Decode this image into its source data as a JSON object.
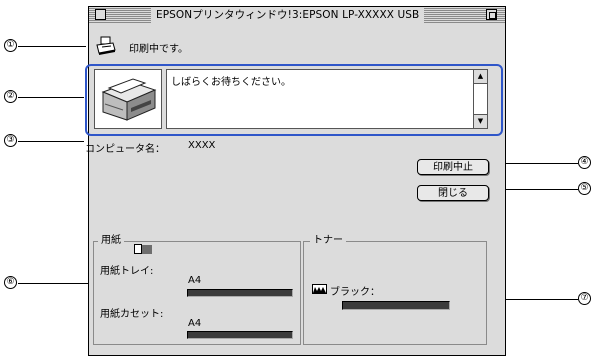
{
  "window": {
    "title": "EPSONプリンタウィンドウ!3:EPSON LP-XXXXX USB",
    "status_text": "印刷中です。",
    "message": "しばらくお待ちください。",
    "computer_label": "コンピュータ名：",
    "computer_name": "XXXX",
    "buttons": {
      "cancel_print": "印刷中止",
      "close": "閉じる"
    },
    "paper_group": {
      "legend": "用紙",
      "tray_label": "用紙トレイ:",
      "tray_size": "A4",
      "tray_level": 1.0,
      "cassette_label": "用紙カセット:",
      "cassette_size": "A4",
      "cassette_level": 1.0
    },
    "toner_group": {
      "legend": "トナー",
      "black_label": "ブラック：",
      "black_level": 1.0
    }
  },
  "callouts": [
    "①",
    "②",
    "③",
    "④",
    "⑤",
    "⑥",
    "⑦"
  ],
  "colors": {
    "callout_frame": "#2f56c9",
    "window_bg": "#dcdcdc",
    "level_bar": "#3b3b3b"
  },
  "icons": {
    "status": "printer-icon",
    "paper": "paper-stack-icon",
    "toner": "toner-icon"
  }
}
